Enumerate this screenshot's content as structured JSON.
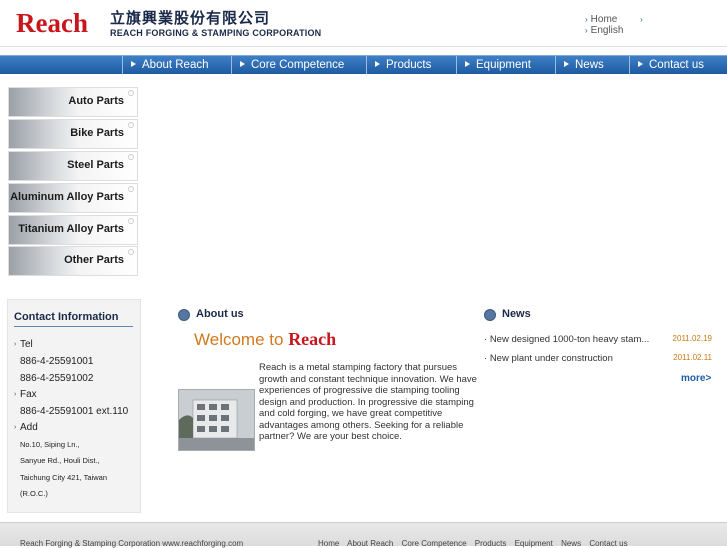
{
  "header": {
    "logo": "Reach",
    "chinese_name": "立旗興業股份有限公司",
    "english_name": "REACH FORGING & STAMPING CORPORATION",
    "top_links": [
      "Home",
      "",
      "English"
    ]
  },
  "nav": [
    "About Reach",
    "Core Competence",
    "Products",
    "Equipment",
    "News",
    "Contact us"
  ],
  "categories": [
    "Auto Parts",
    "Bike Parts",
    "Steel Parts",
    "Aluminum Alloy Parts",
    "Titanium Alloy Parts",
    "Other Parts"
  ],
  "contact": {
    "title": "Contact Information",
    "tel_label": "Tel",
    "tel": [
      "886-4-25591001",
      "886-4-25591002"
    ],
    "fax_label": "Fax",
    "fax": "886-4-25591001 ext.110",
    "add_label": "Add",
    "address": [
      "No.10, Siping Ln.,",
      "Sanyue Rd., Houli Dist.,",
      "Taichung City 421, Taiwan",
      "(R.O.C.)"
    ]
  },
  "about": {
    "title": "About us",
    "welcome": "Welcome to",
    "welcome_brand": "Reach",
    "text": "Reach is a metal stamping factory that pursues growth and constant technique innovation. We have experiences of progressive die stamping tooling design and production. In progressive die stamping and cold forging, we have great competitive advantages among others. Seeking for a reliable partner? We are your best choice."
  },
  "news": {
    "title": "News",
    "items": [
      {
        "title": "New designed 1000-ton heavy stam...",
        "date": "2011.02.19"
      },
      {
        "title": "New plant under construction",
        "date": "2011.02.11"
      }
    ],
    "more": "more>"
  },
  "footer": {
    "text": "Reach Forging & Stamping Corporation www.reachforging.com",
    "links": [
      "Home",
      "About Reach",
      "Core Competence",
      "Products",
      "Equipment",
      "News",
      "Contact us"
    ]
  },
  "colors": {
    "brand": "#c8161d",
    "nav": "#1d5aa0",
    "date": "#c87a14"
  }
}
